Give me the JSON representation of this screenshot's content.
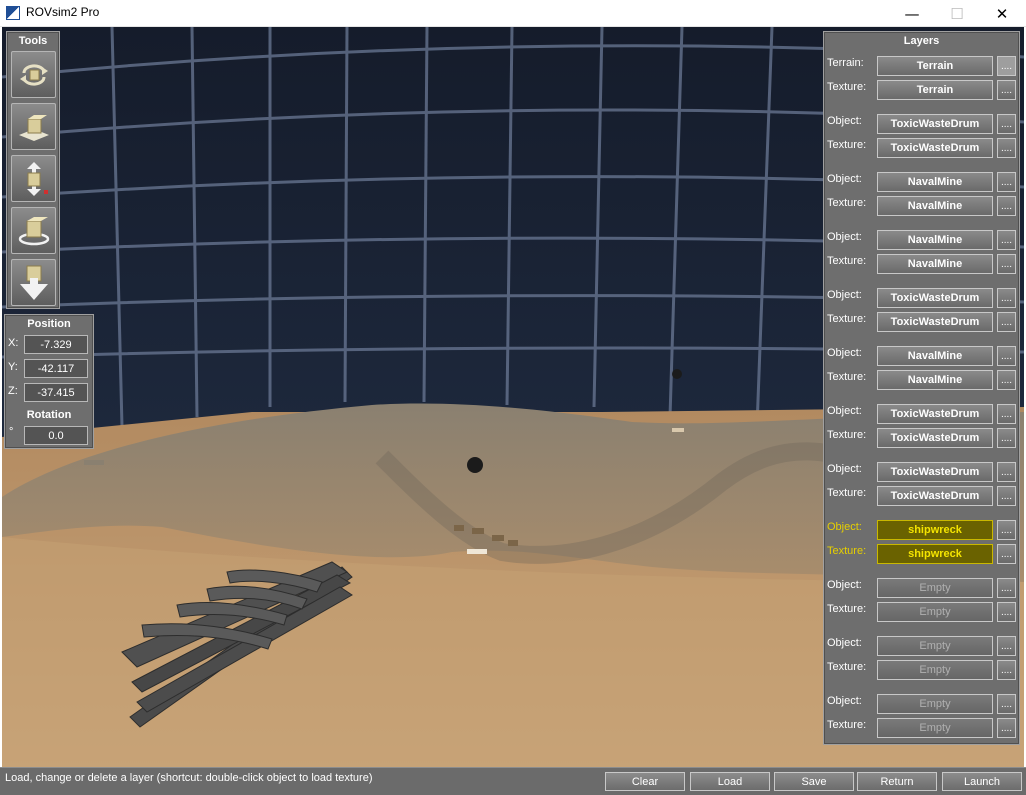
{
  "window": {
    "title": "ROVsim2 Pro",
    "minimize_glyph": "—",
    "maximize_glyph": "☐",
    "close_glyph": "✕"
  },
  "tools": {
    "title": "Tools",
    "buttons": [
      {
        "name": "rotate-view-tool",
        "icon": "rotate-icon"
      },
      {
        "name": "move-object-tool",
        "icon": "move-plane-icon"
      },
      {
        "name": "raise-lower-tool",
        "icon": "vertical-move-icon"
      },
      {
        "name": "rotate-object-tool",
        "icon": "rotate-object-icon"
      },
      {
        "name": "drop-object-tool",
        "icon": "drop-icon"
      }
    ]
  },
  "position": {
    "title": "Position",
    "x_label": "X:",
    "x_value": "-7.329",
    "y_label": "Y:",
    "y_value": "-42.117",
    "z_label": "Z:",
    "z_value": "-37.415",
    "rotation_title": "Rotation",
    "rotation_label": "°",
    "rotation_value": "0.0"
  },
  "layers": {
    "title": "Layers",
    "dots": "....",
    "terrain": [
      {
        "label": "Terrain:",
        "value": "Terrain"
      },
      {
        "label": "Texture:",
        "value": "Terrain"
      }
    ],
    "groups": [
      {
        "object_label": "Object:",
        "object": "ToxicWasteDrum",
        "texture_label": "Texture:",
        "texture": "ToxicWasteDrum",
        "state": "normal"
      },
      {
        "object_label": "Object:",
        "object": "NavalMine",
        "texture_label": "Texture:",
        "texture": "NavalMine",
        "state": "normal"
      },
      {
        "object_label": "Object:",
        "object": "NavalMine",
        "texture_label": "Texture:",
        "texture": "NavalMine",
        "state": "normal"
      },
      {
        "object_label": "Object:",
        "object": "ToxicWasteDrum",
        "texture_label": "Texture:",
        "texture": "ToxicWasteDrum",
        "state": "normal"
      },
      {
        "object_label": "Object:",
        "object": "NavalMine",
        "texture_label": "Texture:",
        "texture": "NavalMine",
        "state": "normal"
      },
      {
        "object_label": "Object:",
        "object": "ToxicWasteDrum",
        "texture_label": "Texture:",
        "texture": "ToxicWasteDrum",
        "state": "normal"
      },
      {
        "object_label": "Object:",
        "object": "ToxicWasteDrum",
        "texture_label": "Texture:",
        "texture": "ToxicWasteDrum",
        "state": "normal"
      },
      {
        "object_label": "Object:",
        "object": "shipwreck",
        "texture_label": "Texture:",
        "texture": "shipwreck",
        "state": "selected"
      },
      {
        "object_label": "Object:",
        "object": "Empty",
        "texture_label": "Texture:",
        "texture": "Empty",
        "state": "empty"
      },
      {
        "object_label": "Object:",
        "object": "Empty",
        "texture_label": "Texture:",
        "texture": "Empty",
        "state": "empty"
      },
      {
        "object_label": "Object:",
        "object": "Empty",
        "texture_label": "Texture:",
        "texture": "Empty",
        "state": "empty"
      }
    ]
  },
  "status": {
    "text": "Load, change or delete a layer (shortcut: double-click object to load texture)"
  },
  "actions": {
    "clear": "Clear",
    "load": "Load",
    "save": "Save",
    "return": "Return",
    "launch": "Launch"
  },
  "colors": {
    "panel": "#6e6e6e",
    "selected_layer": "#f4e400",
    "sky": "#1a2438",
    "sand": "#c09a6e"
  }
}
